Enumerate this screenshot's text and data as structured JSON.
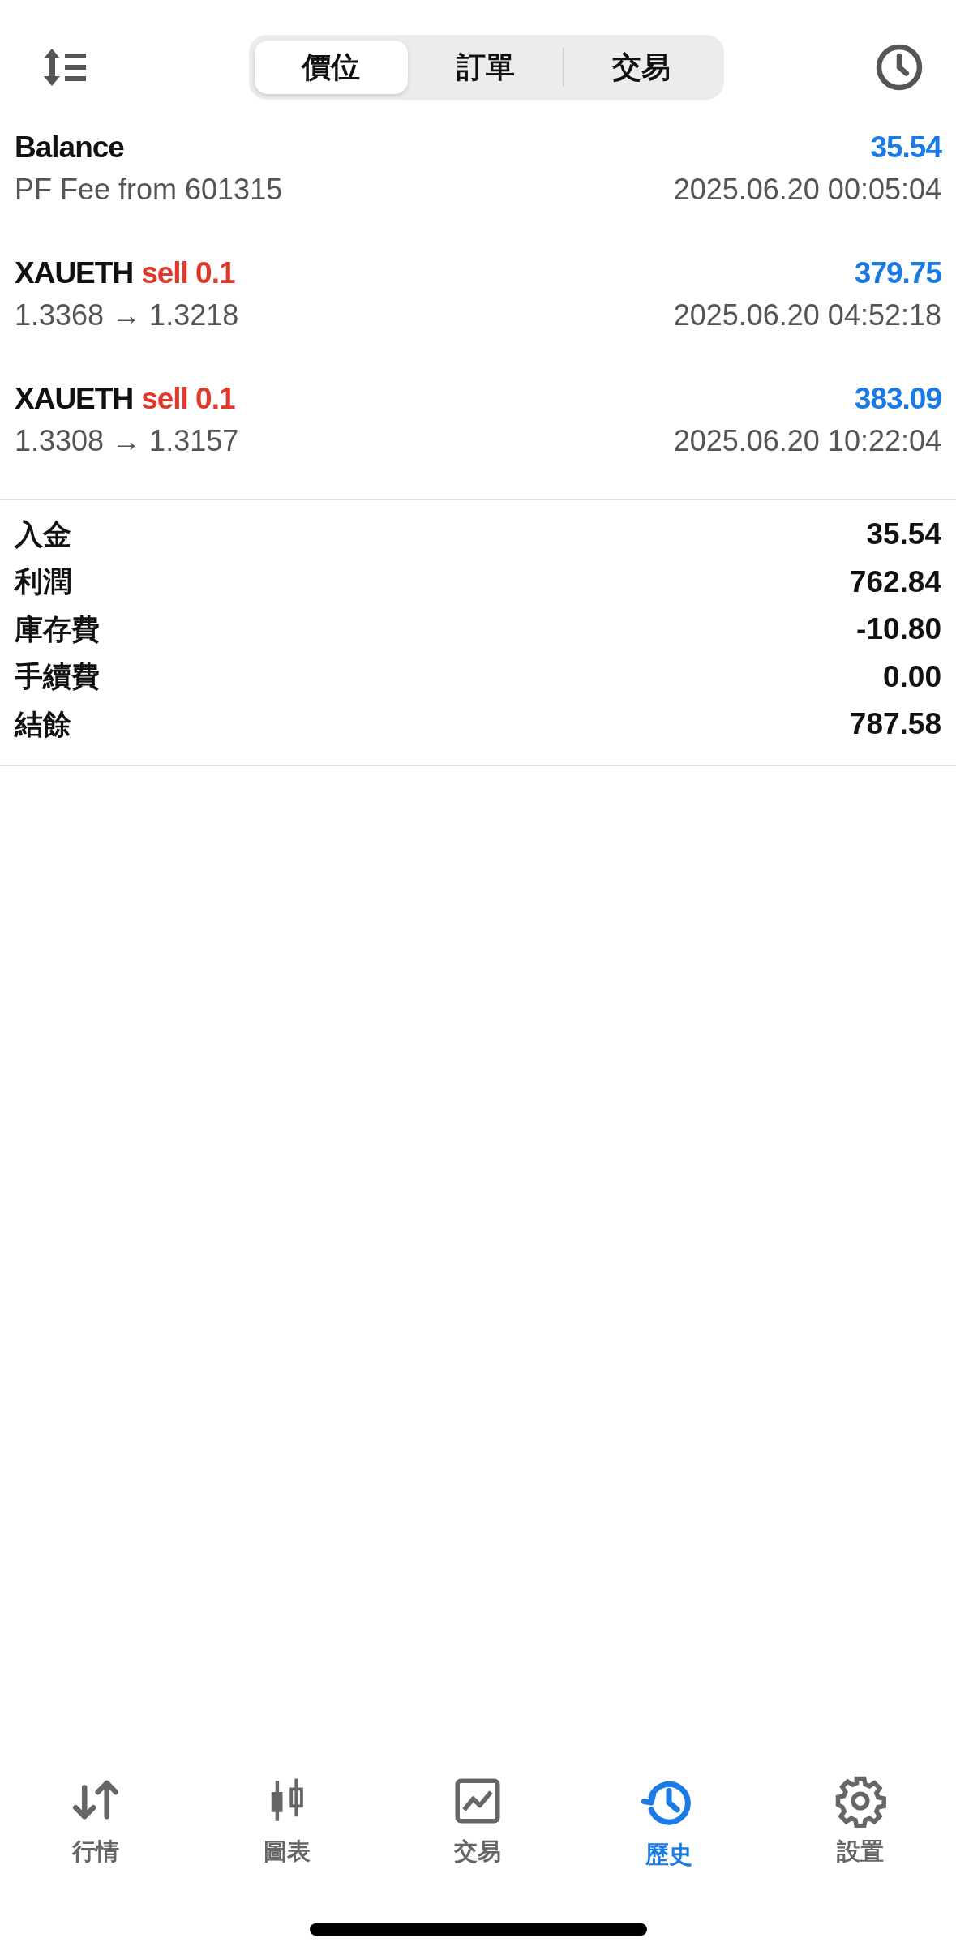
{
  "segments": [
    {
      "label": "價位",
      "selected": true
    },
    {
      "label": "訂單",
      "selected": false
    },
    {
      "label": "交易",
      "selected": false
    }
  ],
  "deals": [
    {
      "kind": "balance",
      "title": "Balance",
      "amount": "35.54",
      "detail": "PF Fee from 601315",
      "time": "2025.06.20 00:05:04"
    },
    {
      "kind": "sell",
      "title": "XAUETH",
      "order": "sell 0.1",
      "amount": "379.75",
      "detail": "1.3368 → 1.3218",
      "time": "2025.06.20 04:52:18"
    },
    {
      "kind": "sell",
      "title": "XAUETH",
      "order": "sell 0.1",
      "amount": "383.09",
      "detail": "1.3308 → 1.3157",
      "time": "2025.06.20 10:22:04"
    }
  ],
  "summary": [
    {
      "label": "入金",
      "value": "35.54"
    },
    {
      "label": "利潤",
      "value": "762.84"
    },
    {
      "label": "庫存費",
      "value": "-10.80"
    },
    {
      "label": "手續費",
      "value": "0.00"
    },
    {
      "label": "結餘",
      "value": "787.58"
    }
  ],
  "nav": [
    {
      "label": "行情",
      "selected": false
    },
    {
      "label": "圖表",
      "selected": false
    },
    {
      "label": "交易",
      "selected": false
    },
    {
      "label": "歷史",
      "selected": true
    },
    {
      "label": "設置",
      "selected": false
    }
  ]
}
